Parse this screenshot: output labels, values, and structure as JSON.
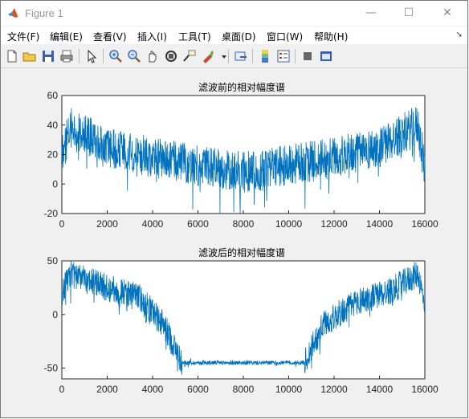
{
  "window": {
    "title": "Figure 1",
    "minimize": "—",
    "maximize": "☐",
    "close": "✕"
  },
  "menu": [
    "文件(F)",
    "编辑(E)",
    "查看(V)",
    "插入(I)",
    "工具(T)",
    "桌面(D)",
    "窗口(W)",
    "帮助(H)"
  ],
  "menu_arrow": "➘",
  "toolbar": [
    "new-figure-icon",
    "open-file-icon",
    "save-icon",
    "print-icon",
    "pointer-icon",
    "zoom-in-icon",
    "zoom-out-icon",
    "pan-icon",
    "rotate-3d-icon",
    "data-cursor-icon",
    "brush-icon",
    "brush-dropdown-icon",
    "link-plot-icon",
    "colorbar-icon",
    "legend-icon",
    "hide-plot-tools-icon",
    "show-plot-tools-icon"
  ],
  "chart_data": [
    {
      "type": "line",
      "title": "滤波前的相对幅度谱",
      "xlim": [
        0,
        16000
      ],
      "ylim": [
        -20,
        60
      ],
      "xticks": [
        "0",
        "2000",
        "4000",
        "6000",
        "8000",
        "10000",
        "12000",
        "14000",
        "16000"
      ],
      "yticks": [
        "-20",
        "0",
        "20",
        "40",
        "60"
      ],
      "color": "#0072bd",
      "series": [
        {
          "x": [
            0,
            400,
            2000,
            4000,
            5500,
            8000,
            9000,
            10500,
            12000,
            14000,
            15700,
            16000
          ],
          "values": [
            20,
            38,
            25,
            18,
            14,
            8,
            10,
            14,
            18,
            25,
            40,
            10
          ]
        }
      ]
    },
    {
      "type": "line",
      "title": "滤波后的相对幅度谱",
      "xlim": [
        0,
        16000
      ],
      "ylim": [
        -60,
        50
      ],
      "xticks": [
        "0",
        "2000",
        "4000",
        "6000",
        "8000",
        "10000",
        "12000",
        "14000",
        "16000"
      ],
      "yticks": [
        "-50",
        "0",
        "50"
      ],
      "color": "#0072bd",
      "series": [
        {
          "x": [
            0,
            400,
            2000,
            3500,
            4500,
            5300,
            6000,
            8000,
            10000,
            10700,
            11500,
            13000,
            14500,
            15700,
            16000
          ],
          "values": [
            20,
            38,
            25,
            15,
            -10,
            -45,
            -45,
            -45,
            -45,
            -45,
            -10,
            12,
            22,
            38,
            10
          ]
        }
      ]
    }
  ]
}
